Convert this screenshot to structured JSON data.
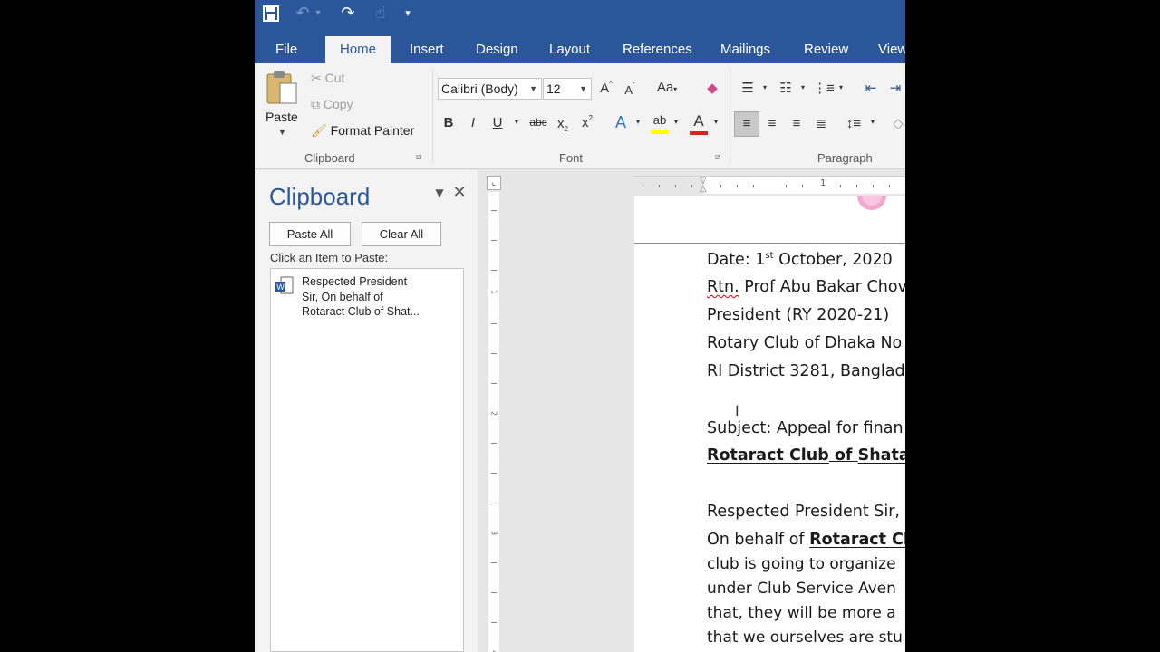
{
  "tabs": [
    "File",
    "Home",
    "Insert",
    "Design",
    "Layout",
    "References",
    "Mailings",
    "Review",
    "View"
  ],
  "ribbon": {
    "clipboard": {
      "paste": "Paste",
      "cut": "Cut",
      "copy": "Copy",
      "format_painter": "Format Painter",
      "label": "Clipboard"
    },
    "font": {
      "family": "Calibri (Body)",
      "size": "12",
      "label": "Font"
    },
    "paragraph": {
      "label": "Paragraph"
    }
  },
  "pane": {
    "title": "Clipboard",
    "paste_all": "Paste All",
    "clear_all": "Clear All",
    "hint": "Click an Item to Paste:",
    "items": [
      {
        "line1": "Respected President",
        "line2": "Sir, On behalf of",
        "line3": "Rotaract Club of Shat..."
      }
    ]
  },
  "ruler": {
    "h_number": "1",
    "v_numbers": [
      "1",
      "2",
      "3",
      "4"
    ]
  },
  "document": {
    "date_prefix": "Date: 1",
    "date_sup": "st",
    "date_suffix": " October, 2020",
    "rtn": "Rtn.",
    "rtn_rest": " Prof Abu Bakar Chov",
    "president": "President (RY 2020-21)",
    "rotary": "Rotary Club of Dhaka No",
    "district": "RI District 3281, Banglad",
    "subject": "Subject: Appeal for finan",
    "rotaract_club": "Rotaract Club",
    "of_word": " of ",
    "shatais": "Shatais",
    "respected": "Respected President Sir,",
    "onbehalf": "On behalf of ",
    "rotaract_cl": "Rotaract Clu",
    "line_club": "club is going to organize",
    "line_under": "under Club Service Aven",
    "line_that": "that, they will be more a",
    "line_ourselves": "that we ourselves are stu"
  }
}
